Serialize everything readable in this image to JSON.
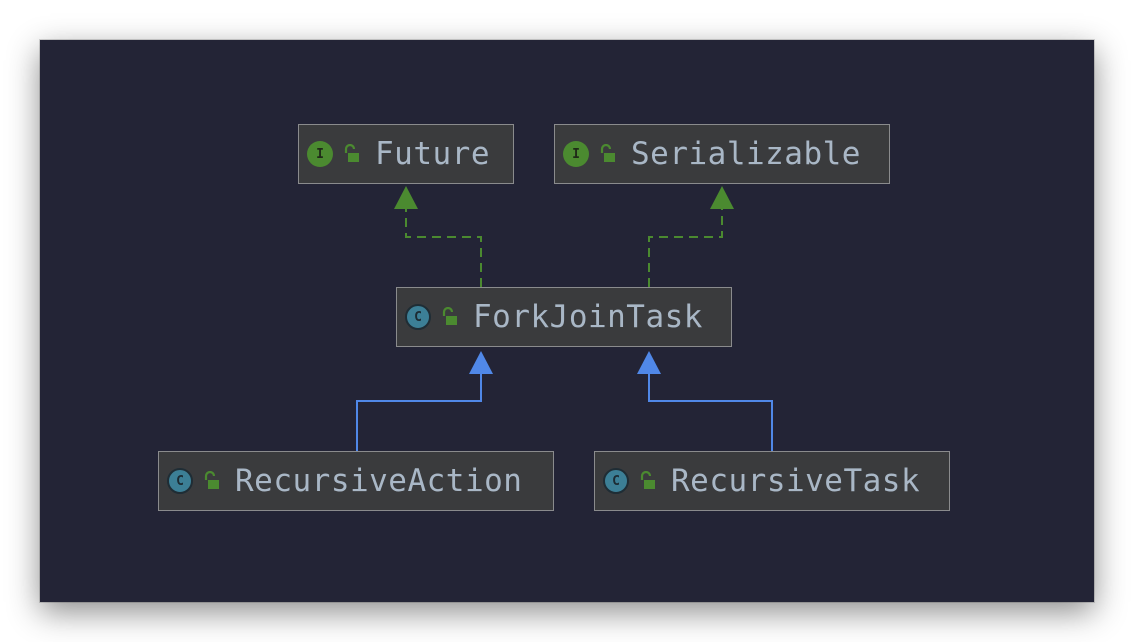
{
  "diagram": {
    "background_color": "#232436",
    "node_fill": "#3a3b3d",
    "implements_edge_color": "#4b8a30",
    "extends_edge_color": "#5088e8",
    "nodes": {
      "future": {
        "label": "Future",
        "kind_letter": "I",
        "kind": "interface",
        "icon": "interface-icon"
      },
      "serializable": {
        "label": "Serializable",
        "kind_letter": "I",
        "kind": "interface",
        "icon": "interface-icon"
      },
      "forkjointask": {
        "label": "ForkJoinTask",
        "kind_letter": "C",
        "kind": "abstract-class",
        "icon": "abstract-class-icon"
      },
      "recursiveaction": {
        "label": "RecursiveAction",
        "kind_letter": "C",
        "kind": "abstract-class",
        "icon": "abstract-class-icon"
      },
      "recursivetask": {
        "label": "RecursiveTask",
        "kind_letter": "C",
        "kind": "abstract-class",
        "icon": "abstract-class-icon"
      }
    },
    "edges": [
      {
        "from": "ForkJoinTask",
        "to": "Future",
        "type": "implements"
      },
      {
        "from": "ForkJoinTask",
        "to": "Serializable",
        "type": "implements"
      },
      {
        "from": "RecursiveAction",
        "to": "ForkJoinTask",
        "type": "extends"
      },
      {
        "from": "RecursiveTask",
        "to": "ForkJoinTask",
        "type": "extends"
      }
    ]
  }
}
